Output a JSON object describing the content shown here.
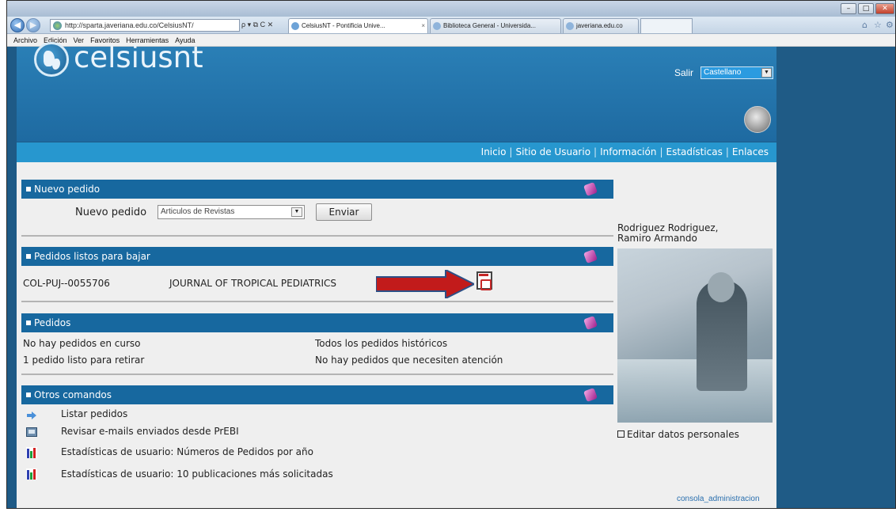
{
  "browser": {
    "address": "http://sparta.javeriana.edu.co/CelsiusNT/",
    "address_controls": "ρ ▾ ⧉ C ✕",
    "tabs": [
      {
        "label": "CelsiusNT - Pontificia Unive...",
        "close": "×"
      },
      {
        "label": "Biblioteca General - Universida..."
      },
      {
        "label": "javeriana.edu.co"
      }
    ],
    "menu": [
      "Archivo",
      "Edición",
      "Ver",
      "Favoritos",
      "Herramientas",
      "Ayuda"
    ],
    "window_buttons": {
      "minimize": "–",
      "maximize": "□",
      "close": "✕"
    },
    "right_icons": [
      "home-icon",
      "star-icon",
      "gear-icon"
    ]
  },
  "header": {
    "logo_text": "celsiusnt",
    "salir": "Salir",
    "language": "Castellano",
    "nav": [
      "Inicio",
      "Sitio de Usuario",
      "Información",
      "Estadísticas",
      "Enlaces"
    ],
    "nav_separator": "|"
  },
  "nuevo_pedido": {
    "title": "Nuevo pedido",
    "label": "Nuevo pedido",
    "select_value": "Articulos de Revistas",
    "button": "Enviar"
  },
  "listos": {
    "title": "Pedidos listos para bajar",
    "code": "COL-PUJ--0055706",
    "journal": "JOURNAL OF TROPICAL PEDIATRICS"
  },
  "pedidos": {
    "title": "Pedidos",
    "items": [
      "No hay pedidos en curso",
      "Todos los pedidos históricos",
      "1 pedido listo para retirar",
      "No hay pedidos que necesiten atención"
    ]
  },
  "otros": {
    "title": "Otros comandos",
    "commands": [
      {
        "label": "Listar pedidos",
        "icon": "arrow-icon"
      },
      {
        "label": "Revisar e-mails enviados desde PrEBI",
        "icon": "email-icon"
      },
      {
        "label": "Estadísticas de usuario: Números de Pedidos por año",
        "icon": "bar-chart-icon"
      },
      {
        "label": "Estadísticas de usuario: 10 publicaciones más solicitadas",
        "icon": "bar-chart-icon"
      }
    ]
  },
  "user": {
    "name_line1": "Rodriguez Rodriguez,",
    "name_line2": "Ramiro Armando",
    "edit": "Editar datos personales"
  },
  "footer": {
    "admin_link": "consola_administracion"
  },
  "colors": {
    "header": "#1e6aa1",
    "navbar": "#2797cf",
    "section": "#17689f",
    "arrow": "#c21b1b"
  }
}
